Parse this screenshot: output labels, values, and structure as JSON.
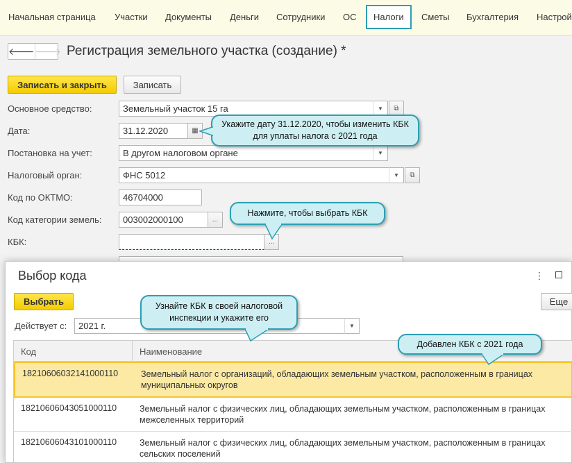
{
  "nav": {
    "items": [
      "Начальная страница",
      "Участки",
      "Документы",
      "Деньги",
      "Сотрудники",
      "ОС",
      "Налоги",
      "Сметы",
      "Бухгалтерия",
      "Настрой"
    ],
    "active": "Налоги"
  },
  "page": {
    "title": "Регистрация земельного участка (создание) *",
    "save_close": "Записать и закрыть",
    "save": "Записать"
  },
  "form": {
    "asset_label": "Основное средство:",
    "asset_value": "Земельный участок 15 га",
    "date_label": "Дата:",
    "date_value": "31.12.2020",
    "registration_label": "Постановка на учет:",
    "registration_value": "В другом налоговом органе",
    "tax_authority_label": "Налоговый орган:",
    "tax_authority_value": "ФНС 5012",
    "oktmo_label": "Код по ОКТМО:",
    "oktmo_value": "46704000",
    "land_category_label": "Код категории земель:",
    "land_category_value": "003002000100",
    "kbk_label": "КБК:",
    "kbk_value": ""
  },
  "callouts": {
    "date_hint": "Укажите дату 31.12.2020, чтобы изменить КБК для уплаты налога с 2021 года",
    "kbk_hint": "Нажмите, чтобы выбрать КБК",
    "inspection_hint": "Узнайте КБК в своей налоговой инспекции и укажите его",
    "added_hint": "Добавлен КБК с 2021 года"
  },
  "modal": {
    "title": "Выбор кода",
    "select_button": "Выбрать",
    "more_button": "Еще",
    "valid_from_label": "Действует с:",
    "valid_from_value": "2021 г.",
    "columns": [
      "Код",
      "Наименование"
    ],
    "rows": [
      {
        "code": "18210606032141000110",
        "name": "Земельный налог с организаций, обладающих земельным участком, расположенным в границах муниципальных округов",
        "selected": true
      },
      {
        "code": "18210606043051000110",
        "name": "Земельный налог с физических лиц, обладающих земельным участком, расположенным в границах межселенных территорий",
        "selected": false
      },
      {
        "code": "18210606043101000110",
        "name": "Земельный налог с физических лиц, обладающих земельным участком, расположенным в границах сельских поселений",
        "selected": false
      }
    ]
  },
  "colors": {
    "accent": "#2e9eb4",
    "primary_button": "#f5cc00",
    "callout_fill": "#cdeff3",
    "selected_row": "#fbe9a4"
  }
}
